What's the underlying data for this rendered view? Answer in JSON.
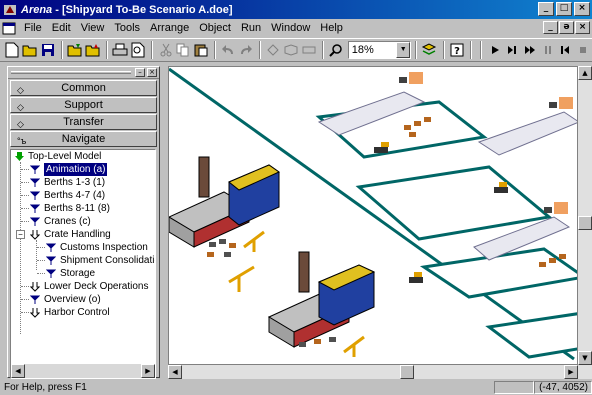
{
  "window": {
    "app_name": "Arena",
    "doc_title": " - [Shipyard To-Be Scenario A.doe]",
    "min": "_",
    "max": "□",
    "close": "×"
  },
  "menu": {
    "items": [
      "File",
      "Edit",
      "View",
      "Tools",
      "Arrange",
      "Object",
      "Run",
      "Window",
      "Help"
    ],
    "mdi_min": "_",
    "mdi_restore": "ə",
    "mdi_close": "×"
  },
  "toolbar": {
    "zoom_value": "18%"
  },
  "project_bar": {
    "tabs": [
      "Common",
      "Support",
      "Transfer",
      "Navigate"
    ],
    "tree": [
      {
        "label": "Top-Level Model"
      },
      {
        "label": "Animation (a)",
        "selected": true
      },
      {
        "label": "Berths 1-3 (1)"
      },
      {
        "label": "Berths 4-7 (4)"
      },
      {
        "label": "Berths 8-11 (8)"
      },
      {
        "label": "Cranes (c)"
      },
      {
        "label": "Crate Handling"
      },
      {
        "label": "Customs Inspection"
      },
      {
        "label": "Shipment Consolidation"
      },
      {
        "label": "Storage"
      },
      {
        "label": "Lower Deck Operations"
      },
      {
        "label": "Overview (o)"
      },
      {
        "label": "Harbor Control"
      }
    ]
  },
  "status": {
    "help_text": "For Help, press F1",
    "coords": "(-47, 4052)"
  },
  "colors": {
    "title_bar": "#000080",
    "dock_outline": "#006666",
    "crate": "#b5651d"
  }
}
